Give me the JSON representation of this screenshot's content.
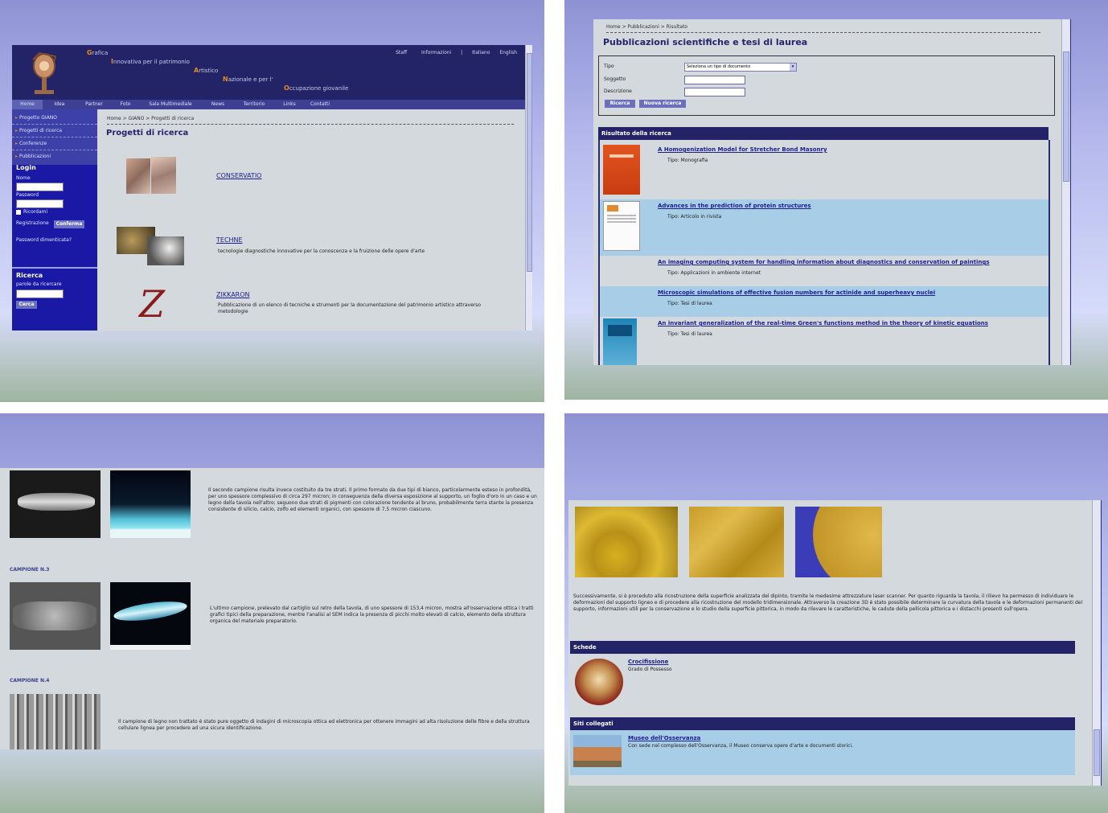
{
  "q1": {
    "logo_letters": [
      "G",
      "I",
      "A",
      "N",
      "O"
    ],
    "logo_words": [
      "rafica",
      "nnovativa per il patrimonio",
      "rtistico",
      "azionale e per l'",
      "ccupazione giovanile"
    ],
    "top_links": [
      "Staff",
      "Informazioni",
      "|",
      "Italiano",
      "English"
    ],
    "nav": [
      "Home",
      "Idea",
      "Partner",
      "Foto",
      "Sala Multimediale",
      "News",
      "Territorio",
      "Links",
      "Contatti"
    ],
    "sidebar_items": [
      "Progetto GIANO",
      "Progetti di ricerca",
      "Conferenze",
      "Pubblicazioni"
    ],
    "login": {
      "title": "Login",
      "user_label": "Nome",
      "pass_label": "Password",
      "remember": "Ricordami",
      "register": "Registrazione",
      "button": "Conferma",
      "forgot": "Password dimenticata?"
    },
    "search": {
      "title": "Ricerca",
      "label": "parole da ricercare",
      "button": "Cerca"
    },
    "breadcrumb": "Home > GIANO > Progetti di ricerca",
    "heading": "Progetti di ricerca",
    "projects": [
      {
        "title": "CONSERVATIO",
        "desc": ""
      },
      {
        "title": "TECHNE",
        "desc": "tecnologie diagnostiche innovative per la conoscenza e la fruizione delle opere d'arte"
      },
      {
        "title": "ZIKKARON",
        "desc": "Pubblicazione di un elenco di tecniche e strumenti per la documentazione del patrimonio artistico attraverso metodologie"
      }
    ],
    "colors": {
      "navy": "#232468",
      "side": "#1919a6",
      "accent": "#e58a1b"
    }
  },
  "q2": {
    "breadcrumb": "Home > Pubblicazioni > Risultato",
    "title": "Pubblicazioni scientifiche e tesi di laurea",
    "form": {
      "tipo_label": "Tipo",
      "tipo_value": "Seleziona un tipo di documento",
      "soggetto_label": "Soggetto",
      "descrizione_label": "Descrizione",
      "search_btn": "Ricerca",
      "new_btn": "Nuova ricerca"
    },
    "results_header": "Risultato della ricerca",
    "results": [
      {
        "title": "A Homogenization Model for Stretcher Bond Masonry",
        "type": "Tipo: Monografia"
      },
      {
        "title": "Advances in the prediction of protein structures",
        "type": "Tipo: Articolo in rivista"
      },
      {
        "title": "An imaging computing system for handling information about diagnostics and conservation of paintings",
        "type": "Tipo: Applicazioni in ambiente internet"
      },
      {
        "title": "Microscopic simulations of effective fusion numbers for actinide and superheavy nuclei",
        "type": "Tipo: Tesi di laurea"
      },
      {
        "title": "An invariant generalization of the real-time Green's functions method in the theory of kinetic equations",
        "type": "Tipo: Tesi di laurea"
      }
    ]
  },
  "q3": {
    "sections": [
      {
        "label": "",
        "text": "Il secondo campione risulta invece costituito da tre strati. Il primo formato da due tipi di bianco, particolarmente esteso in profondità, per uno spessore complessivo di circa 297 micron; in conseguenza della diversa esposizione al supporto, un foglio d'oro in un caso e un legno della tavola nell'altro; seguono due strati di pigmenti con colorazione tendente al bruno, probabilmente terra stante la presenza consistente di silicio, calcio, zolfo ed elementi organici, con spessore di 7,5 micron ciascuno."
      },
      {
        "label": "CAMPIONE N.3",
        "text": "L'ultimo campione, prelevato dal cartiglio sul retro della tavola, di uno spessore di 153,4 micron, mostra all'osservazione ottica i tratti grafici tipici della preparazione, mentre l'analisi al SEM indica la presenza di picchi molto elevati di calcio, elemento della struttura organica del materiale preparatorio."
      },
      {
        "label": "CAMPIONE N.4",
        "text": "Il campione di legno non trattato è stato pure oggetto di indagini di microscopia ottica ed elettronica per ottenere immagini ad alta risoluzione delle fibre e della struttura cellulare lignea per procedere ad una sicura identificazione."
      }
    ]
  },
  "q4": {
    "body_text": "Successivamente, si è proceduto alla ricostruzione della superficie analizzata del dipinto, tramite le medesime attrezzature laser scanner. Per quanto riguarda la tavola, il rilievo ha permesso di individuare le deformazioni del supporto ligneo e di procedere alla ricostruzione del modello tridimensionale. Attraverso la creazione 3D è stato possibile determinare la curvatura della tavola e le deformazioni permanenti del supporto, informazioni utili per la conservazione e lo studio della superficie pittorica, in modo da rilevare le caratteristiche, le cadute della pellicola pittorica e i distacchi presenti sull'opera.",
    "schede_header": "Schede",
    "scheda": {
      "title": "Crocifissione",
      "subtitle": "Grado di Possesso"
    },
    "siti_header": "Siti collegati",
    "sito": {
      "title": "Museo dell'Osservanza",
      "desc": "Con sede nel complesso dell'Osservanza, il Museo conserva opere d'arte e documenti storici."
    }
  }
}
